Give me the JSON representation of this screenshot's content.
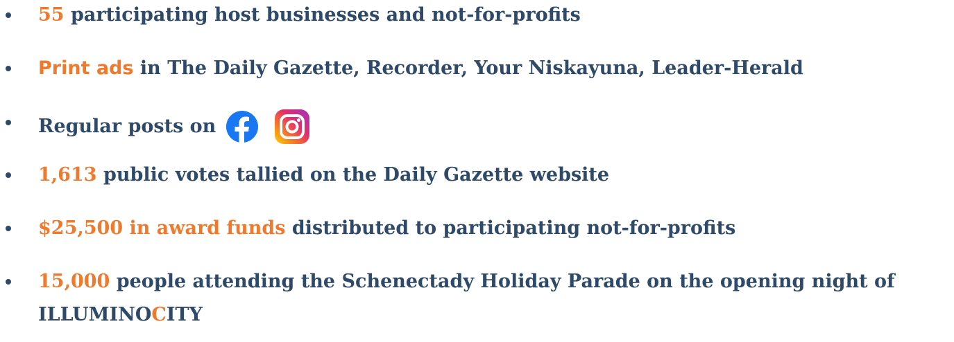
{
  "items": [
    {
      "highlight": "55",
      "text": "participating host businesses and not-for-profits"
    },
    {
      "highlight": "Print ads",
      "text": "in The Daily Gazette, Recorder, Your Niskayuna, Leader-Herald"
    },
    {
      "text": "Regular posts on",
      "icons": [
        "facebook-icon",
        "instagram-icon"
      ]
    },
    {
      "highlight": "1,613",
      "text": "public votes tallied on the Daily Gazette website"
    },
    {
      "highlight": "$25,500 in award funds",
      "text": "distributed to participating not-for-profits"
    },
    {
      "highlight": "15,000",
      "text": "people attending the Schenectady Holiday Parade on the opening night of",
      "brand_part1": "ILLUMINO",
      "brand_part2": "C",
      "brand_part3": "ITY"
    }
  ],
  "colors": {
    "text": "#2f4a68",
    "highlight": "#ee7a2e",
    "facebook": "#1877f2"
  }
}
